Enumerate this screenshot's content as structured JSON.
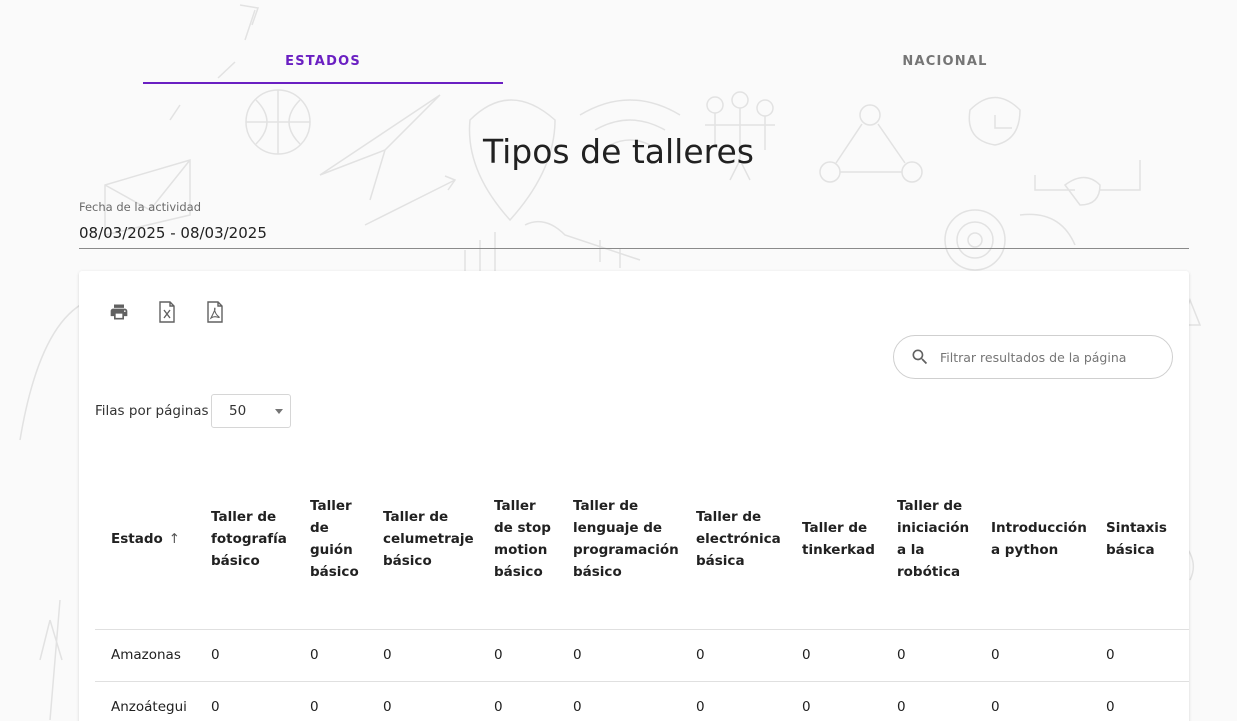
{
  "tabs": [
    {
      "label": "ESTADOS",
      "active": true
    },
    {
      "label": "NACIONAL",
      "active": false
    }
  ],
  "page_title": "Tipos de talleres",
  "date_filter": {
    "label": "Fecha de la actividad",
    "value": "08/03/2025 - 08/03/2025"
  },
  "toolbar": {
    "print_icon": "print-icon",
    "excel_icon": "excel-icon",
    "pdf_icon": "pdf-icon"
  },
  "search": {
    "placeholder": "Filtrar resultados de la página"
  },
  "pagination": {
    "rows_label": "Filas por páginas",
    "rows_value": "50"
  },
  "table": {
    "columns": [
      "Estado",
      "Taller de fotografía básico",
      "Taller de guión básico",
      "Taller de celumetraje básico",
      "Taller de stop motion básico",
      "Taller de lenguaje de programación básico",
      "Taller de electrónica básica",
      "Taller de tinkerkad",
      "Taller de iniciación a la robótica",
      "Introducción a python",
      "Sintaxis básica"
    ],
    "sort_icon": "arrow-up-icon",
    "rows": [
      [
        "Amazonas",
        "0",
        "0",
        "0",
        "0",
        "0",
        "0",
        "0",
        "0",
        "0",
        "0"
      ],
      [
        "Anzoátegui",
        "0",
        "0",
        "0",
        "0",
        "0",
        "0",
        "0",
        "0",
        "0",
        "0"
      ]
    ]
  },
  "colors": {
    "accent": "#6a1fc2",
    "inactive_tab": "#757575",
    "background": "#fafafa"
  }
}
